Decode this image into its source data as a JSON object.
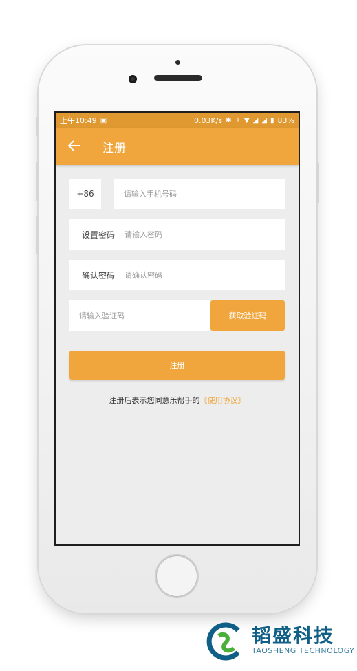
{
  "status_bar": {
    "time": "上午10:49",
    "network_speed": "0.03K/s",
    "battery": "83%"
  },
  "app_bar": {
    "title": "注册",
    "back_icon": "arrow-left-icon"
  },
  "form": {
    "country_code": "+86",
    "phone_placeholder": "请输入手机号码",
    "password_label": "设置密码",
    "password_placeholder": "请输入密码",
    "confirm_label": "确认密码",
    "confirm_placeholder": "请确认密码",
    "code_placeholder": "请输入验证码",
    "get_code_label": "获取验证码",
    "register_label": "注册",
    "agreement_prefix": "注册后表示您同意乐帮手的",
    "agreement_link": "《使用协议》"
  },
  "colors": {
    "accent": "#f0a63c",
    "status_bar": "#e09830",
    "brand_blue": "#0f5f86",
    "brand_green": "#4caf3c"
  },
  "watermark": {
    "name": "韬盛科技",
    "subtitle": "TAOSHENG TECHNOLOGY"
  }
}
